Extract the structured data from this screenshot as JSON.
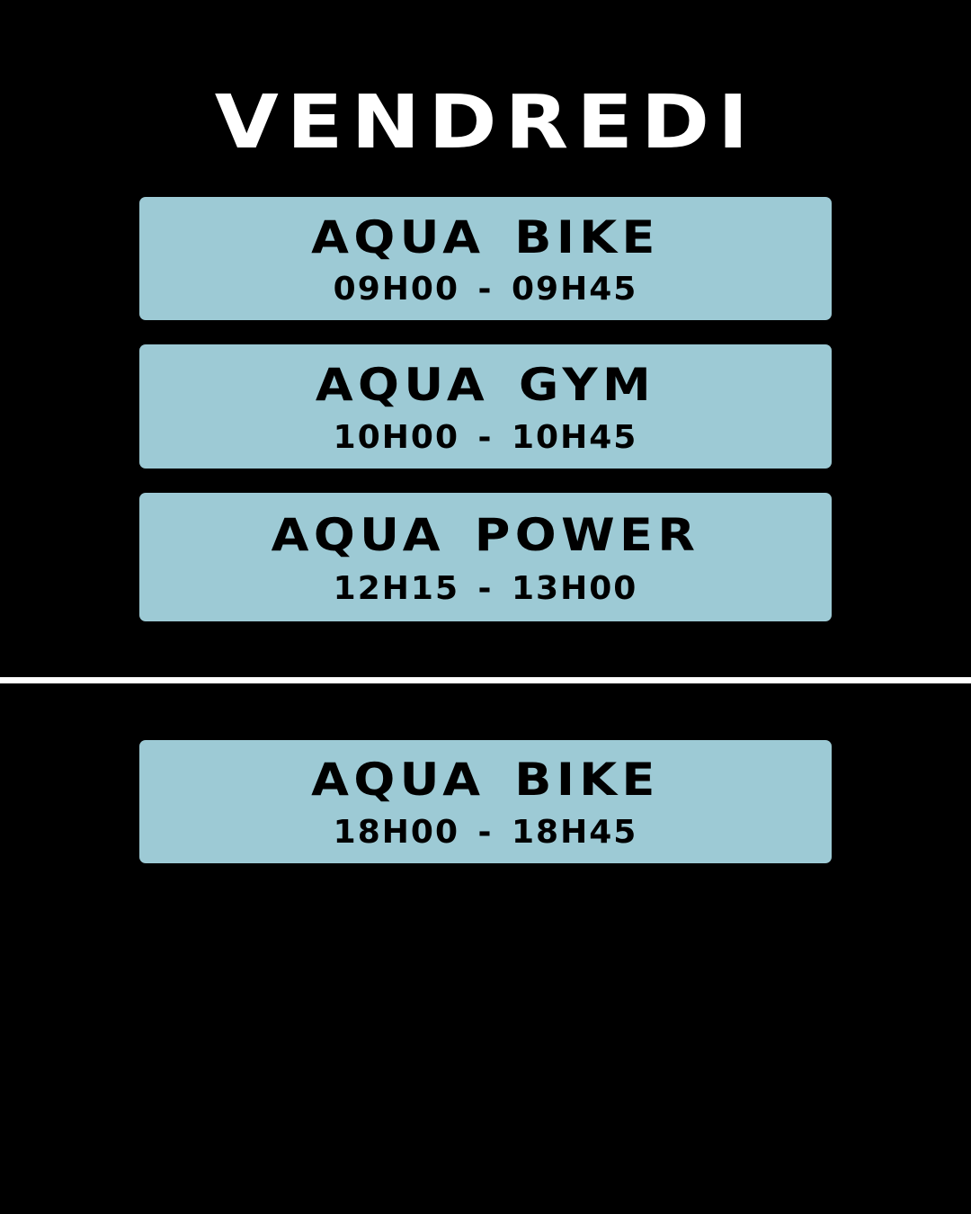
{
  "title": "VENDREDI",
  "colors": {
    "background": "#000000",
    "card": "#9dcad5",
    "text_on_card": "#000000",
    "title_text": "#ffffff",
    "divider": "#ffffff"
  },
  "morning_classes": [
    {
      "name": "AQUA BIKE",
      "time": "09H00 - 09H45"
    },
    {
      "name": "AQUA GYM",
      "time": "10H00 - 10H45"
    },
    {
      "name": "AQUA POWER",
      "time": "12H15 - 13H00"
    }
  ],
  "evening_classes": [
    {
      "name": "AQUA BIKE",
      "time": "18H00 - 18H45"
    }
  ]
}
